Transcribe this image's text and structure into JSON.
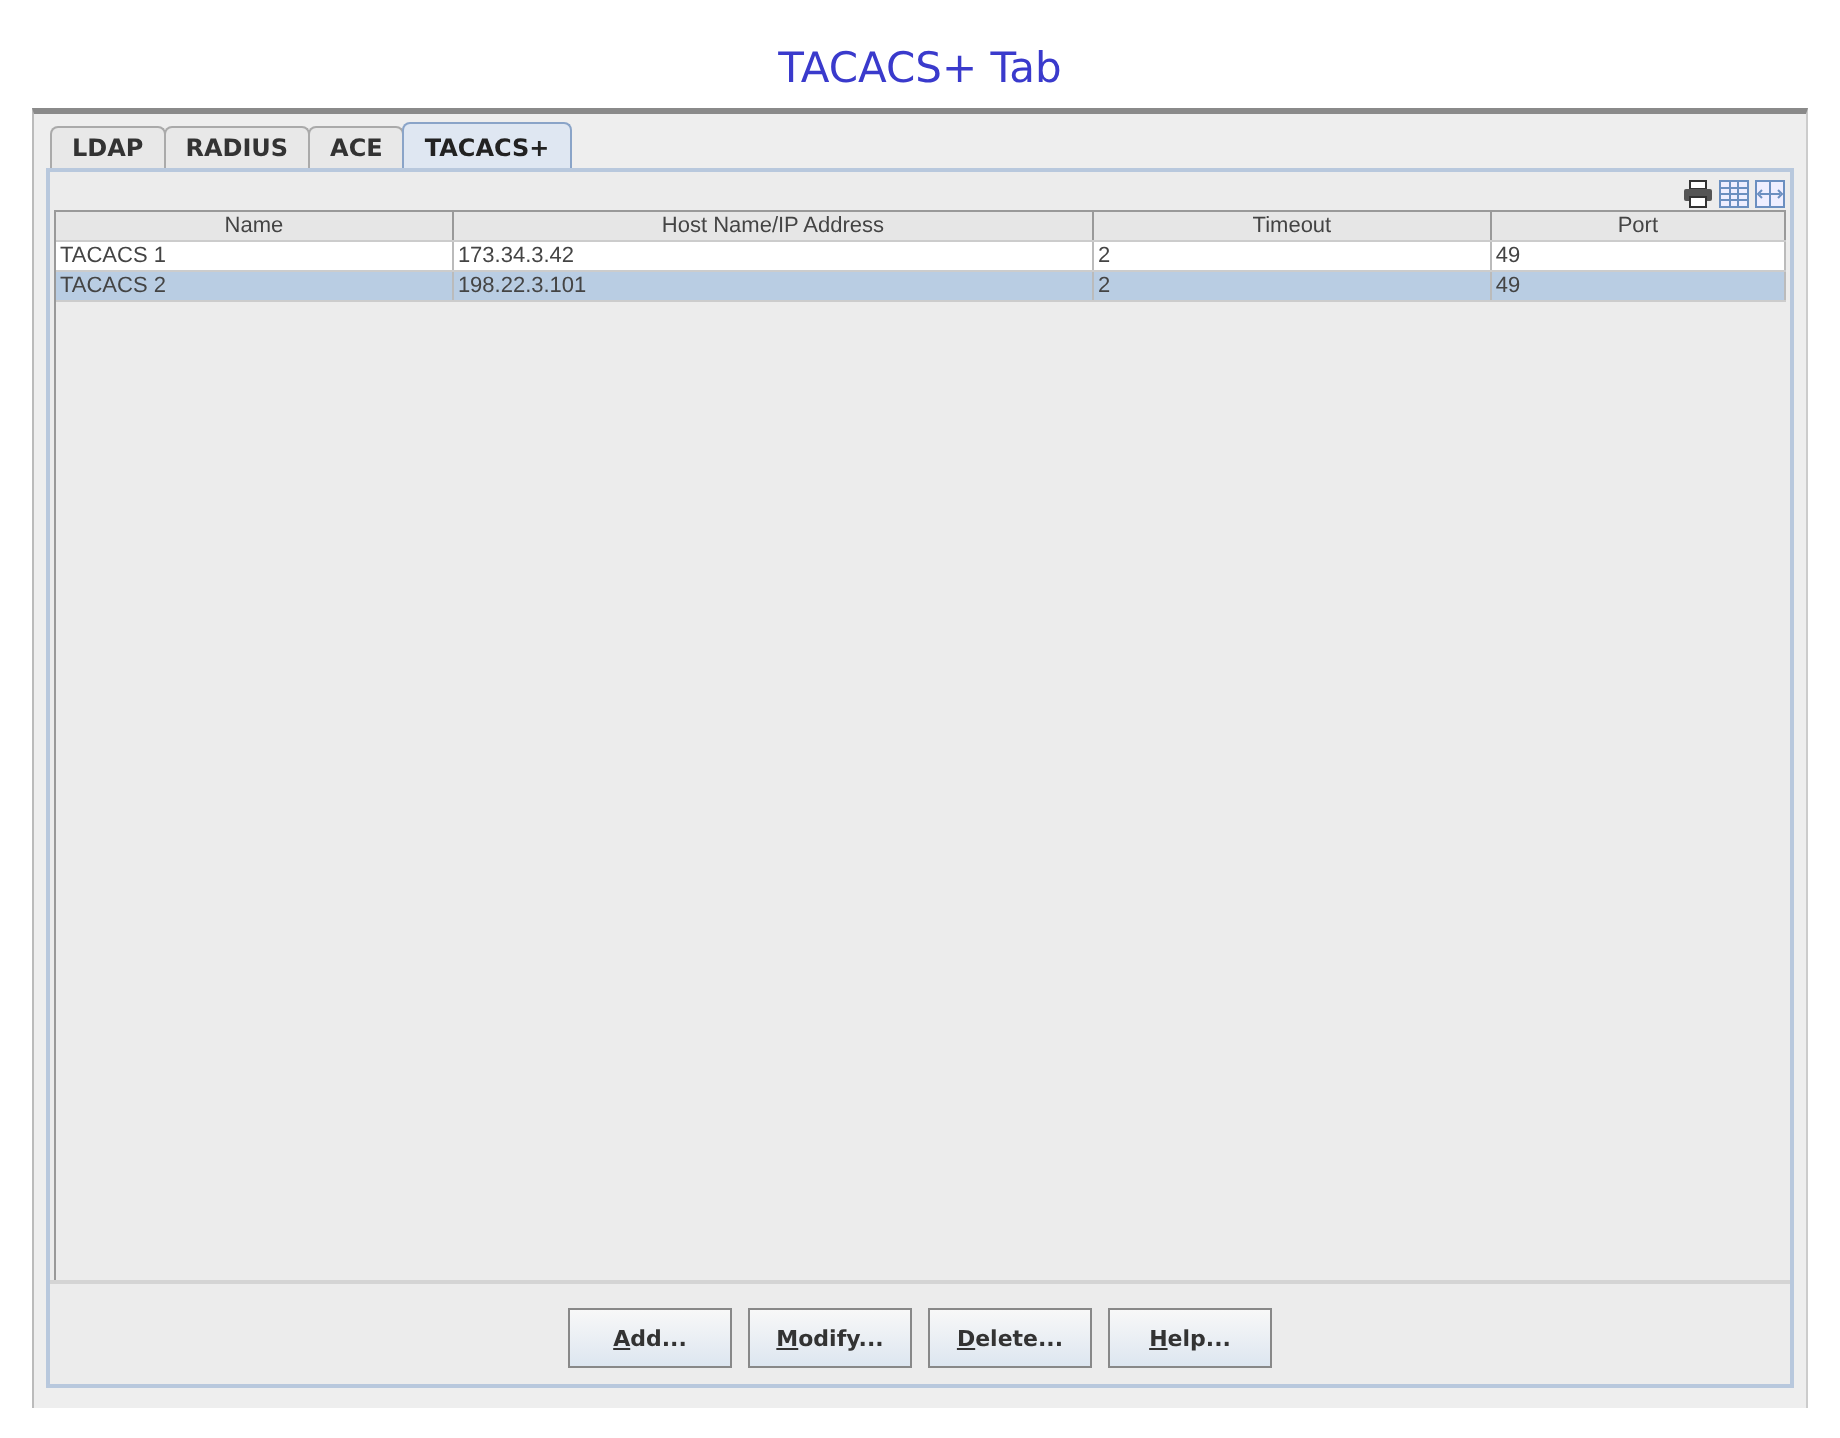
{
  "page_title": "TACACS+ Tab",
  "tabs": [
    {
      "label": "LDAP",
      "selected": false
    },
    {
      "label": "RADIUS",
      "selected": false
    },
    {
      "label": "ACE",
      "selected": false
    },
    {
      "label": "TACACS+",
      "selected": true
    }
  ],
  "table": {
    "columns": [
      "Name",
      "Host Name/IP Address",
      "Timeout",
      "Port"
    ],
    "rows": [
      {
        "cells": [
          "TACACS 1",
          "173.34.3.42",
          "2",
          "49"
        ],
        "selected": false
      },
      {
        "cells": [
          "TACACS 2",
          "198.22.3.101",
          "2",
          "49"
        ],
        "selected": true
      }
    ]
  },
  "buttons": [
    "Add...",
    "Modify...",
    "Delete...",
    "Help..."
  ]
}
